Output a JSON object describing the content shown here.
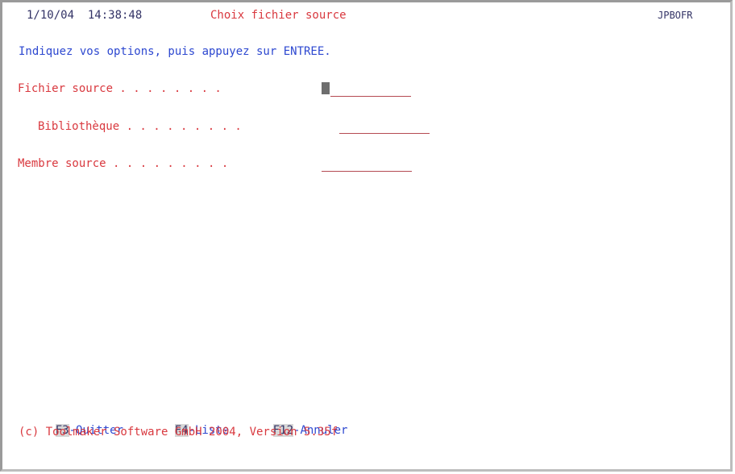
{
  "header": {
    "datetime": "1/10/04  14:38:48",
    "title": "Choix fichier source",
    "program_id": "JPBOFR"
  },
  "instruction": "Indiquez vos options, puis appuyez sur ENTREE.",
  "fields": {
    "fichier_source": {
      "label": "Fichier source . . . . . . . .",
      "value": ""
    },
    "bibliotheque": {
      "label": "Bibliothèque . . . . . . . . .",
      "value": ""
    },
    "membre_source": {
      "label": "Membre source . . . . . . . . .",
      "value": ""
    }
  },
  "function_keys": [
    {
      "key": "F3",
      "label": "-Quitter"
    },
    {
      "key": "F4",
      "label": "-Liste"
    },
    {
      "key": "F12",
      "label": "-Annuler"
    }
  ],
  "copyright": "(c) Toolmaker Software GmbH 2004, Version 5.35f",
  "colors": {
    "red": "#d9393f",
    "blue": "#2d48d0",
    "field_underline": "#b54a52",
    "fkey_highlight": "#d7d7d7"
  }
}
